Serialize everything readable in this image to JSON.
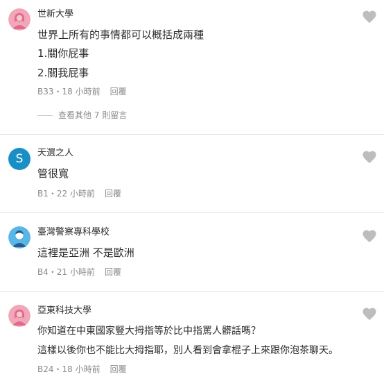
{
  "comments": [
    {
      "author": "世新大學",
      "lines": [
        "世界上所有的事情都可以概括成兩種",
        "1.關你屁事",
        "2.關我屁事"
      ],
      "floor": "B33",
      "time": "18 小時前",
      "reply_label": "回覆",
      "more_replies": "查看其他 7 則留言",
      "avatar_type": "female-icon",
      "avatar_color": "#f2a7b8"
    },
    {
      "author": "天選之人",
      "lines": [
        "管很寬"
      ],
      "floor": "B1",
      "time": "22 小時前",
      "reply_label": "回覆",
      "avatar_type": "letter",
      "avatar_letter": "S",
      "avatar_color": "#1a8fc6"
    },
    {
      "author": "臺灣警察專科學校",
      "lines": [
        "這裡是亞洲 不是歐洲"
      ],
      "floor": "B4",
      "time": "21 小時前",
      "reply_label": "回覆",
      "avatar_type": "male-icon",
      "avatar_color": "#58b7e6"
    },
    {
      "author": "亞東科技大學",
      "lines": [
        "你知道在中東國家豎大拇指等於比中指罵人髒話嗎？",
        "這樣以後你也不能比大拇指耶，別人看到會拿棍子上來跟你泡茶聊天。"
      ],
      "floor": "B24",
      "time": "18 小時前",
      "reply_label": "回覆",
      "avatar_type": "female-icon",
      "avatar_color": "#f2a7b8"
    }
  ],
  "meta_separator": "・",
  "colors": {
    "text": "#2b2b2b",
    "muted": "#8a8a8a",
    "heart": "#bdbdbd",
    "divider": "#e3e3e3"
  }
}
